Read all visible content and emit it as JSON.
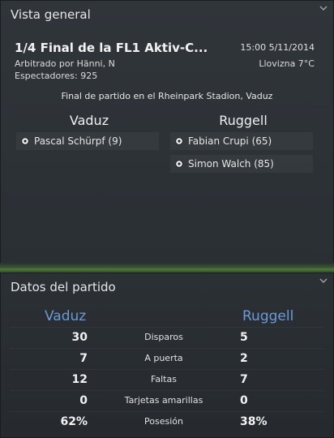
{
  "overview": {
    "title": "Vista general",
    "match_title": "1/4 Final de la FL1 Aktiv-C...",
    "datetime": "15:00 5/11/2014",
    "referee": "Arbitrado por Hänni, N",
    "weather": "Llovizna 7°C",
    "spectators": "Espectadores: 925",
    "result_line": "Final de partido en el Rheinpark Stadion, Vaduz",
    "home": {
      "name": "Vaduz",
      "scorers": [
        "Pascal Schürpf (9)"
      ]
    },
    "away": {
      "name": "Ruggell",
      "scorers": [
        "Fabian Crupi (65)",
        "Simon Walch (85)"
      ]
    }
  },
  "stats": {
    "title": "Datos del partido",
    "home_team": "Vaduz",
    "away_team": "Ruggell",
    "rows": [
      {
        "label": "Disparos",
        "home": "30",
        "away": "5"
      },
      {
        "label": "A puerta",
        "home": "7",
        "away": "2"
      },
      {
        "label": "Faltas",
        "home": "12",
        "away": "7"
      },
      {
        "label": "Tarjetas amarillas",
        "home": "0",
        "away": "0"
      },
      {
        "label": "Posesión",
        "home": "62%",
        "away": "38%"
      }
    ]
  },
  "colors": {
    "team_accent": "#6a9bd8",
    "divider": "#4e7a36"
  },
  "icons": {
    "collapse": "chevron-down-icon",
    "goal": "football-icon"
  }
}
